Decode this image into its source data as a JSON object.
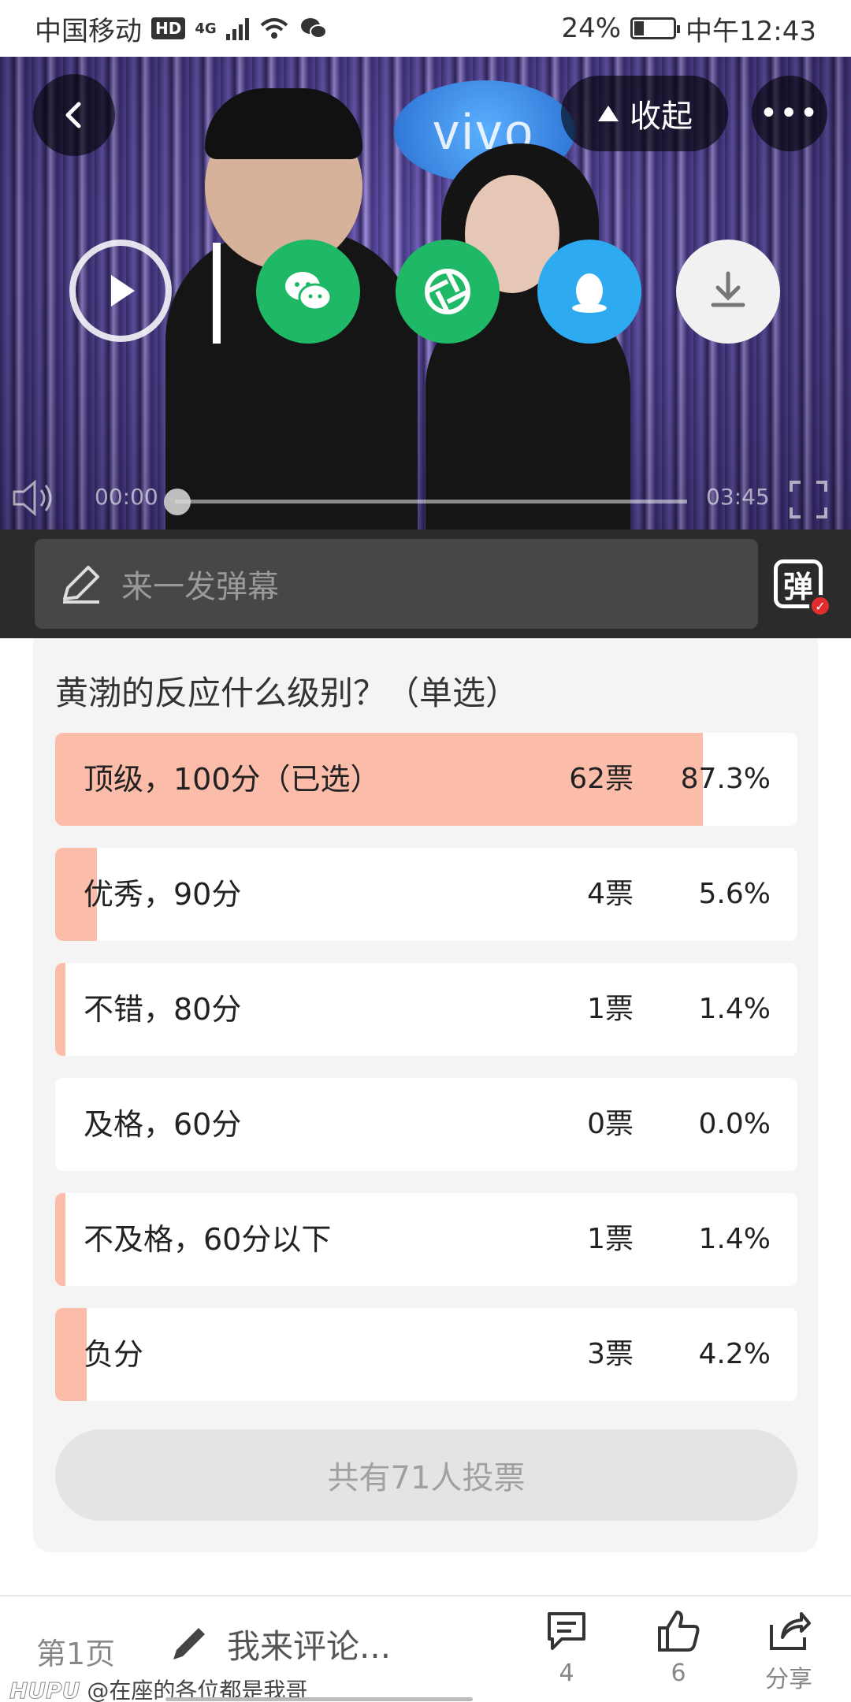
{
  "status_bar": {
    "carrier": "中国移动",
    "hd": "HD",
    "network": "4G",
    "battery": "24%",
    "time": "中午12:43"
  },
  "video": {
    "collapse_label": "收起",
    "more_label": "•••",
    "time_current": "00:00",
    "time_total": "03:45",
    "progress": 0.0,
    "sign_text": "vivo"
  },
  "danmaku": {
    "placeholder": "来一发弹幕",
    "toggle_label": "弹"
  },
  "poll": {
    "title": "黄渤的反应什么级别？（单选）",
    "options": [
      {
        "label": "顶级，100分（已选）",
        "votes": "62票",
        "percent": "87.3%",
        "ratio": 0.873
      },
      {
        "label": "优秀，90分",
        "votes": "4票",
        "percent": "5.6%",
        "ratio": 0.056
      },
      {
        "label": "不错，80分",
        "votes": "1票",
        "percent": "1.4%",
        "ratio": 0.014
      },
      {
        "label": "及格，60分",
        "votes": "0票",
        "percent": "0.0%",
        "ratio": 0.0
      },
      {
        "label": "不及格，60分以下",
        "votes": "1票",
        "percent": "1.4%",
        "ratio": 0.014
      },
      {
        "label": "负分",
        "votes": "3票",
        "percent": "4.2%",
        "ratio": 0.042
      }
    ],
    "total": "共有71人投票"
  },
  "bottom_bar": {
    "page": "第1页",
    "comment_placeholder": "我来评论...",
    "comments_count": "4",
    "likes_count": "6",
    "share_label": "分享"
  },
  "watermark": {
    "brand": "HUPU",
    "user": "@在座的各位都是我哥"
  },
  "colors": {
    "poll_fill": "#fbbcaa",
    "wechat_green": "#1fb866",
    "qq_blue": "#2eaaf0",
    "danmaku_bar": "#2b2b2b"
  }
}
